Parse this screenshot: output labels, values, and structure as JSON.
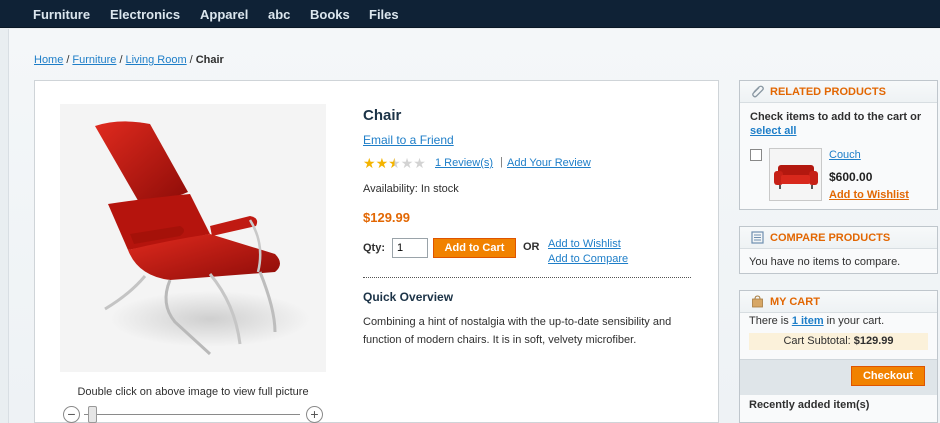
{
  "nav": {
    "items": [
      "Furniture",
      "Electronics",
      "Apparel",
      "abc",
      "Books",
      "Files"
    ]
  },
  "breadcrumb": {
    "home": "Home",
    "furniture": "Furniture",
    "living_room": "Living Room",
    "current": "Chair",
    "separator": "/"
  },
  "product": {
    "name": "Chair",
    "email_friend": "Email to a Friend",
    "rating_stars": 2.5,
    "rating_max": 5,
    "reviews_link": "1 Review(s)",
    "review_separator": "|",
    "add_review": "Add Your Review",
    "availability": "Availability: In stock",
    "price": "$129.99",
    "qty_label": "Qty:",
    "qty_value": "1",
    "add_to_cart": "Add to Cart",
    "or_label": "OR",
    "add_to_wishlist": "Add to Wishlist",
    "add_to_compare": "Add to Compare",
    "quick_overview_title": "Quick Overview",
    "quick_overview_text": "Combining a hint of nostalgia with the up-to-date sensibility and function of modern chairs. It is in soft, velvety microfiber.",
    "zoom_hint": "Double click on above image to view full picture",
    "zoom_level": 0.0
  },
  "sidebar": {
    "related": {
      "title": "Related Products",
      "intro": "Check items to add to the cart or",
      "select_all": "select all",
      "item_name": "Couch",
      "item_price": "$600.00",
      "item_wishlist": "Add to Wishlist"
    },
    "compare": {
      "title": "Compare Products",
      "text": "You have no items to compare."
    },
    "cart": {
      "title": "My Cart",
      "text_before": "There is",
      "item_count_link": "1 item",
      "text_after": "in your cart.",
      "subtotal_label": "Cart Subtotal:",
      "subtotal_value": "$129.99",
      "checkout": "Checkout",
      "recent_title": "Recently added item(s)"
    }
  },
  "colors": {
    "accent": "#f18200",
    "link": "#1e7ec8",
    "nav_bg": "#0f2236",
    "price": "#e26703"
  }
}
